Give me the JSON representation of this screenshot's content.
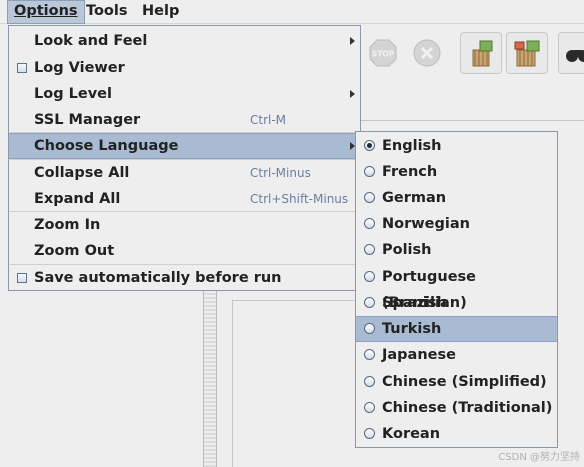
{
  "menubar": [
    {
      "label": "Options",
      "active": true
    },
    {
      "label": "Tools",
      "active": false
    },
    {
      "label": "Help",
      "active": false
    }
  ],
  "toolbar": {
    "icons": [
      "stop-icon",
      "shutdown-icon",
      "clear-icon",
      "clear-all-icon",
      "search-binoculars-icon"
    ]
  },
  "options_menu": {
    "items": [
      {
        "label": "Look and Feel",
        "shortcut": "",
        "submenu": true
      },
      {
        "label": "Log Viewer",
        "shortcut": "",
        "checkbox": true
      },
      {
        "label": "Log Level",
        "shortcut": "",
        "submenu": true
      },
      {
        "label": "SSL Manager",
        "shortcut": "Ctrl-M"
      },
      {
        "label": "Choose Language",
        "shortcut": "",
        "submenu": true,
        "highlighted": true
      },
      {
        "label": "Collapse All",
        "shortcut": "Ctrl-Minus"
      },
      {
        "label": "Expand All",
        "shortcut": "Ctrl+Shift-Minus"
      },
      {
        "label": "Zoom In",
        "shortcut": ""
      },
      {
        "label": "Zoom Out",
        "shortcut": ""
      },
      {
        "label": "Save automatically before run",
        "shortcut": "",
        "checkbox": true
      }
    ]
  },
  "language_submenu": {
    "selected": "English",
    "hovered": "Turkish",
    "items": [
      "English",
      "French",
      "German",
      "Norwegian",
      "Polish",
      "Portuguese (Brazilian)",
      "Spanish",
      "Turkish",
      "Japanese",
      "Chinese (Simplified)",
      "Chinese (Traditional)",
      "Korean"
    ]
  },
  "watermark": "CSDN @努力坚持",
  "colors": {
    "highlight": "#a9bbd3",
    "menu_bg": "#eeeeee",
    "shortcut": "#6a7ea0"
  }
}
